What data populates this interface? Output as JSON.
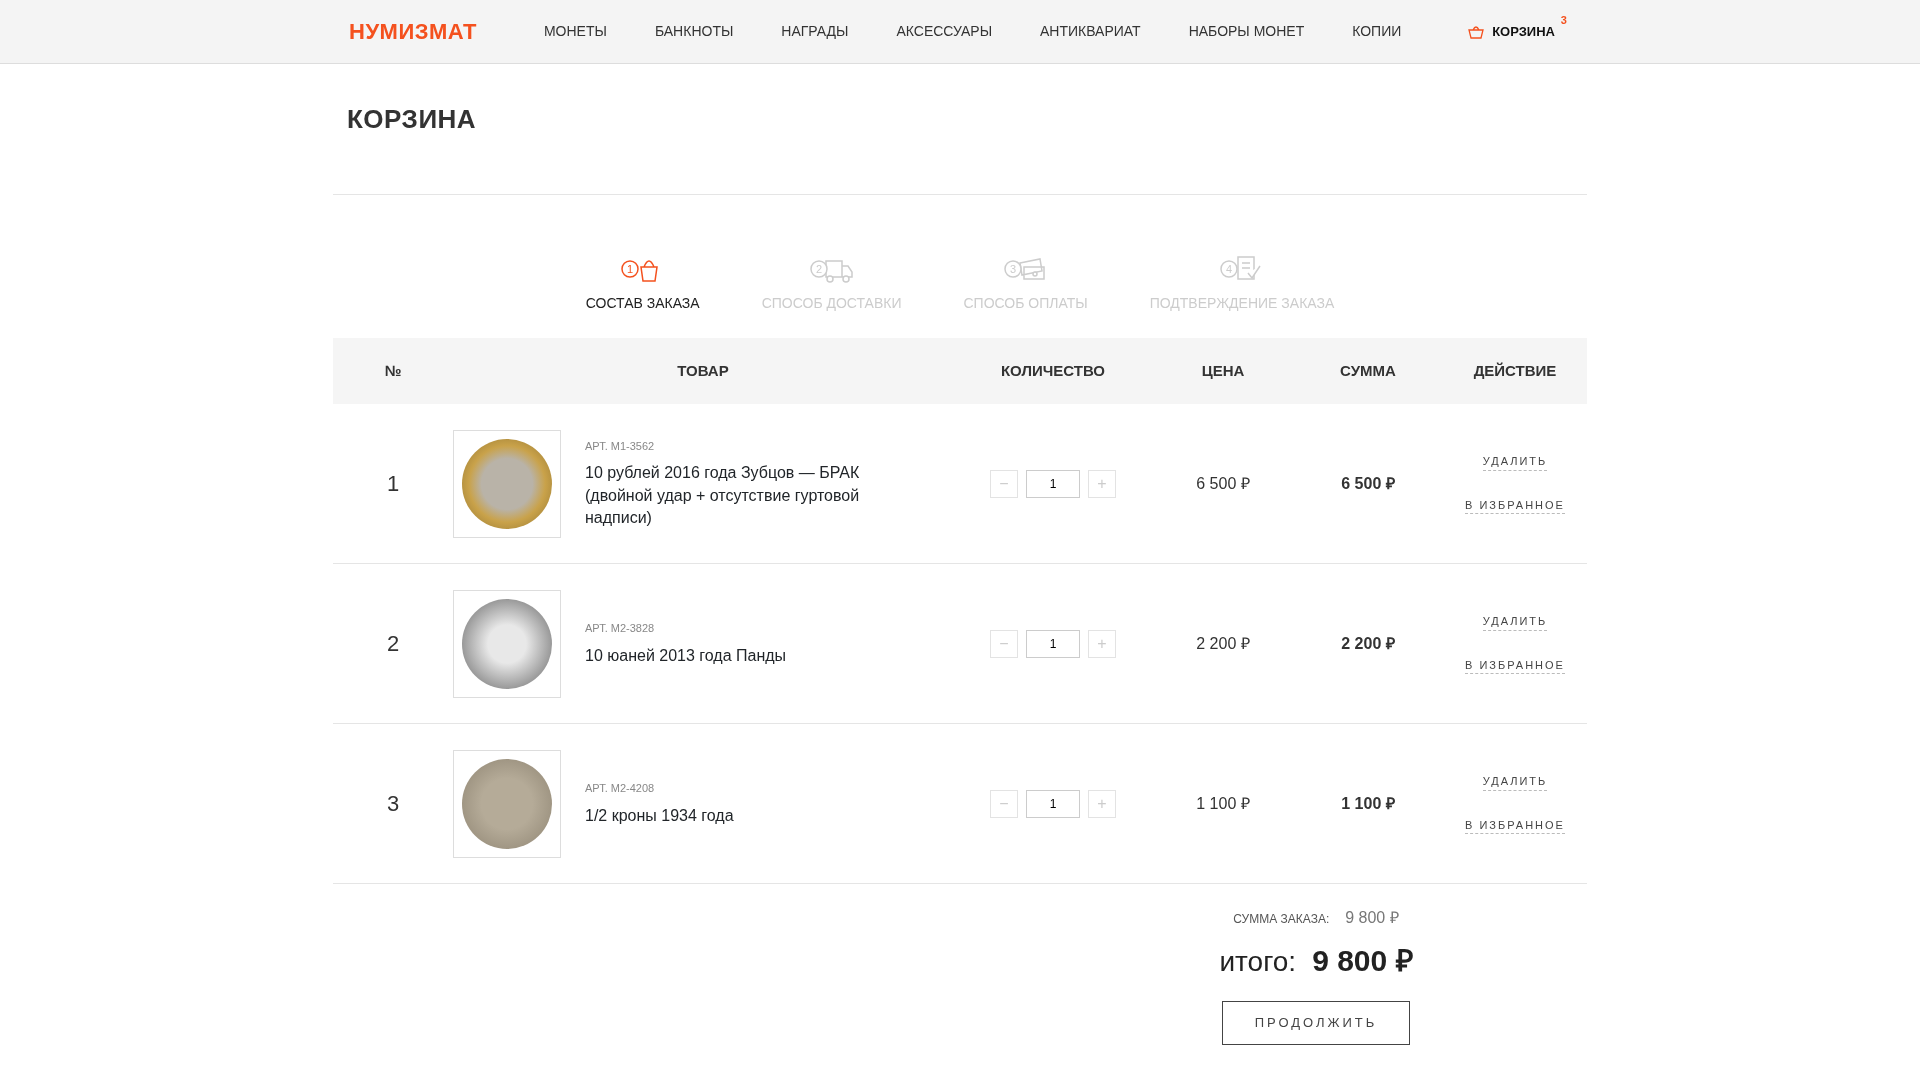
{
  "header": {
    "logo": "НУМИЗМАТ",
    "nav": [
      "МОНЕТЫ",
      "БАНКНОТЫ",
      "НАГРАДЫ",
      "АКСЕССУАРЫ",
      "АНТИКВАРИАТ",
      "НАБОРЫ МОНЕТ",
      "КОПИИ"
    ],
    "cart": {
      "label": "КОРЗИНА",
      "count": "3"
    }
  },
  "title": "КОРЗИНА",
  "steps": [
    {
      "kind": "basket",
      "number": "1",
      "label": "СОСТАВ ЗАКАЗА",
      "selected": true
    },
    {
      "kind": "truck",
      "number": "2",
      "label": "СПОСОБ ДОСТАВКИ",
      "selected": false
    },
    {
      "kind": "card",
      "number": "3",
      "label": "СПОСОБ ОПЛАТЫ",
      "selected": false
    },
    {
      "kind": "document",
      "number": "4",
      "label": "ПОДТВЕРЖДЕНИЕ ЗАКАЗА",
      "selected": false
    }
  ],
  "table": {
    "columns": [
      "№",
      "ТОВАР",
      "КОЛИЧЕСТВО",
      "ЦЕНА",
      "СУММА",
      "ДЕЙСТВИЕ"
    ],
    "rows": [
      {
        "number": "1",
        "sku": "АРТ. М1-3562",
        "name": "10 рублей 2016 года Зубцов — БРАК (двойной удар + отсутствие гуртовой надписи)",
        "minus": "−",
        "quantity": "1",
        "plus": "+",
        "price": "6 500 ₽",
        "sum": "6 500 ₽",
        "remove": "УДАЛИТЬ",
        "favorite": "В ИЗБРАННОЕ"
      },
      {
        "number": "2",
        "sku": "АРТ. М2-3828",
        "name": "10 юаней 2013 года Панды",
        "minus": "−",
        "quantity": "1",
        "plus": "+",
        "price": "2 200 ₽",
        "sum": "2 200 ₽",
        "remove": "УДАЛИТЬ",
        "favorite": "В ИЗБРАННОЕ"
      },
      {
        "number": "3",
        "sku": "АРТ. М2-4208",
        "name": "1/2 кроны 1934 года",
        "minus": "−",
        "quantity": "1",
        "plus": "+",
        "price": "1 100 ₽",
        "sum": "1 100 ₽",
        "remove": "УДАЛИТЬ",
        "favorite": "В ИЗБРАННОЕ"
      }
    ]
  },
  "totals": {
    "subtotal_label": "СУММА ЗАКАЗА:",
    "subtotal": "9 800 ₽",
    "total_label": "итого:",
    "total": "9 800 ₽"
  },
  "continue_button": "ПРОДОЛЖИТЬ"
}
